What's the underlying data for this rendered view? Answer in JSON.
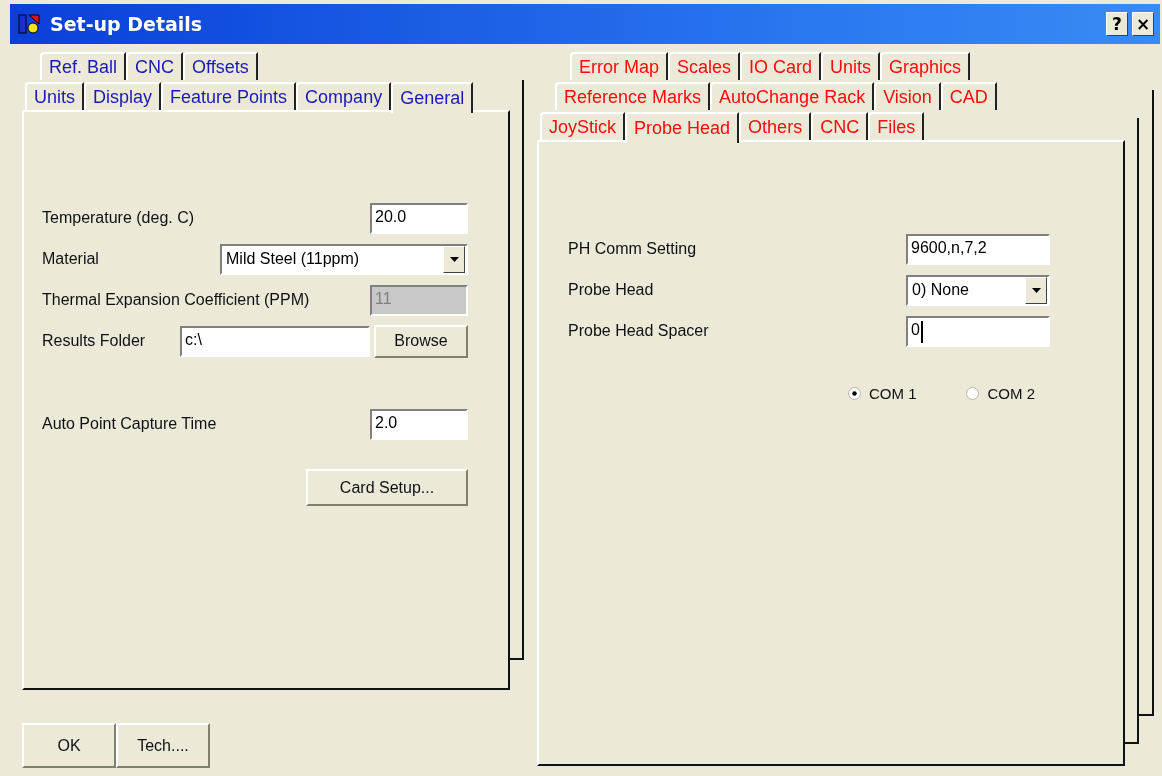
{
  "window": {
    "title": "Set-up Details",
    "buttons": [
      "?",
      "×"
    ]
  },
  "panels": [
    {
      "tab_rows": [
        [
          {
            "label": "Ref. Ball",
            "selected": false
          },
          {
            "label": "CNC",
            "selected": false
          },
          {
            "label": "Offsets",
            "selected": false
          }
        ],
        [
          {
            "label": "Units",
            "selected": false
          },
          {
            "label": "Display",
            "selected": false
          },
          {
            "label": "Feature Points",
            "selected": false
          },
          {
            "label": "Company",
            "selected": false
          },
          {
            "label": "General",
            "selected": true
          }
        ]
      ],
      "field_groups": [
        [
          {
            "kind": "text",
            "label": "Temperature (deg. C)",
            "value": "20.0",
            "disabled": false,
            "focused": false
          },
          {
            "kind": "select",
            "label": "Material",
            "value": "Mild Steel (11ppm)",
            "disabled": false
          },
          {
            "kind": "text",
            "label": "Thermal Expansion Coefficient (PPM)",
            "value": "11",
            "disabled": true,
            "focused": false
          },
          {
            "kind": "browse",
            "label": "Results Folder",
            "value": "c:\\",
            "button": "Browse",
            "disabled": false
          }
        ],
        [
          {
            "kind": "text",
            "label": "Auto Point Capture Time",
            "value": "2.0",
            "disabled": false,
            "focused": false
          }
        ]
      ],
      "button": "Card Setup..."
    },
    {
      "tab_rows": [
        [
          {
            "label": "Error Map",
            "selected": false
          },
          {
            "label": "Scales",
            "selected": false
          },
          {
            "label": "IO Card",
            "selected": false
          },
          {
            "label": "Units",
            "selected": false
          },
          {
            "label": "Graphics",
            "selected": false
          }
        ],
        [
          {
            "label": "Reference Marks",
            "selected": false
          },
          {
            "label": "AutoChange Rack",
            "selected": false
          },
          {
            "label": "Vision",
            "selected": false
          },
          {
            "label": "CAD",
            "selected": false
          }
        ],
        [
          {
            "label": "JoyStick",
            "selected": false
          },
          {
            "label": "Probe Head",
            "selected": true
          },
          {
            "label": "Others",
            "selected": false
          },
          {
            "label": "CNC",
            "selected": false
          },
          {
            "label": "Files",
            "selected": false
          }
        ]
      ],
      "field_groups": [
        [
          {
            "kind": "text",
            "label": "PH Comm Setting",
            "value": "9600,n,7,2",
            "disabled": false,
            "focused": false
          },
          {
            "kind": "select",
            "label": "Probe Head",
            "value": "0) None",
            "disabled": false
          },
          {
            "kind": "text",
            "label": "Probe Head Spacer",
            "value": "0",
            "disabled": false,
            "focused": true
          }
        ]
      ],
      "radios": [
        {
          "label": "COM 1",
          "selected": true
        },
        {
          "label": "COM 2",
          "selected": false
        }
      ]
    }
  ],
  "buttons": [
    "OK",
    "Tech...."
  ]
}
